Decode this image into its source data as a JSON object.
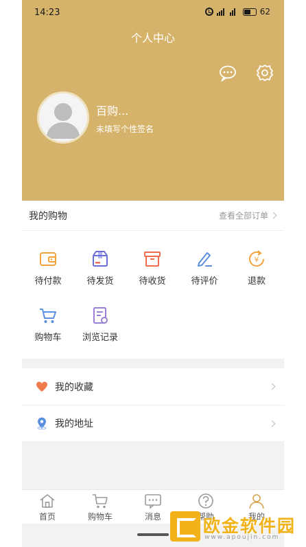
{
  "status_bar": {
    "time": "14:23",
    "battery": "62"
  },
  "header": {
    "title": "个人中心",
    "username": "百购...",
    "signature": "未填写个性签名"
  },
  "orders": {
    "title": "我的购物",
    "view_all": "查看全部订单",
    "items": [
      {
        "label": "待付款",
        "icon": "wallet-icon"
      },
      {
        "label": "待发货",
        "icon": "box-icon"
      },
      {
        "label": "待收货",
        "icon": "package-icon"
      },
      {
        "label": "待评价",
        "icon": "pen-icon"
      },
      {
        "label": "退款",
        "icon": "refund-icon"
      },
      {
        "label": "购物车",
        "icon": "cart-icon"
      },
      {
        "label": "浏览记录",
        "icon": "history-icon"
      }
    ]
  },
  "list": [
    {
      "label": "我的收藏",
      "icon": "heart-icon"
    },
    {
      "label": "我的地址",
      "icon": "location-icon"
    }
  ],
  "tabbar": [
    {
      "label": "首页",
      "icon": "home-icon"
    },
    {
      "label": "购物车",
      "icon": "cart-icon"
    },
    {
      "label": "消息",
      "icon": "message-icon"
    },
    {
      "label": "帮助",
      "icon": "help-icon"
    },
    {
      "label": "我的",
      "icon": "user-icon"
    }
  ],
  "watermark": {
    "name": "欧金软件园",
    "url": "www.apoujin.com"
  },
  "colors": {
    "header_bg": "#d6b36a",
    "accent_orange": "#f2a23c",
    "accent_blue": "#5b8fe0",
    "accent_purple": "#9b7fd6",
    "accent_red": "#ef6b4f"
  }
}
